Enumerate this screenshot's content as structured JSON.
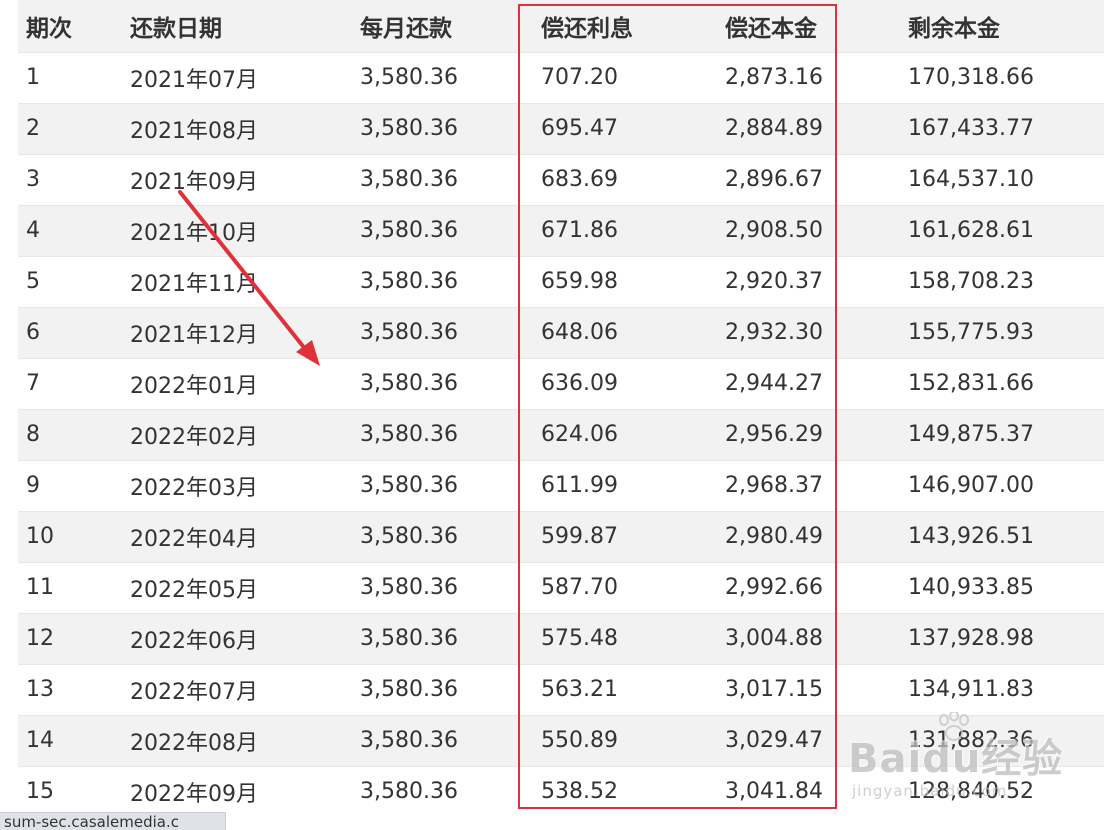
{
  "table": {
    "headers": [
      "期次",
      "还款日期",
      "每月还款",
      "偿还利息",
      "偿还本金",
      "剩余本金"
    ],
    "rows": [
      [
        "1",
        "2021年07月",
        "3,580.36",
        "707.20",
        "2,873.16",
        "170,318.66"
      ],
      [
        "2",
        "2021年08月",
        "3,580.36",
        "695.47",
        "2,884.89",
        "167,433.77"
      ],
      [
        "3",
        "2021年09月",
        "3,580.36",
        "683.69",
        "2,896.67",
        "164,537.10"
      ],
      [
        "4",
        "2021年10月",
        "3,580.36",
        "671.86",
        "2,908.50",
        "161,628.61"
      ],
      [
        "5",
        "2021年11月",
        "3,580.36",
        "659.98",
        "2,920.37",
        "158,708.23"
      ],
      [
        "6",
        "2021年12月",
        "3,580.36",
        "648.06",
        "2,932.30",
        "155,775.93"
      ],
      [
        "7",
        "2022年01月",
        "3,580.36",
        "636.09",
        "2,944.27",
        "152,831.66"
      ],
      [
        "8",
        "2022年02月",
        "3,580.36",
        "624.06",
        "2,956.29",
        "149,875.37"
      ],
      [
        "9",
        "2022年03月",
        "3,580.36",
        "611.99",
        "2,968.37",
        "146,907.00"
      ],
      [
        "10",
        "2022年04月",
        "3,580.36",
        "599.87",
        "2,980.49",
        "143,926.51"
      ],
      [
        "11",
        "2022年05月",
        "3,580.36",
        "587.70",
        "2,992.66",
        "140,933.85"
      ],
      [
        "12",
        "2022年06月",
        "3,580.36",
        "575.48",
        "3,004.88",
        "137,928.98"
      ],
      [
        "13",
        "2022年07月",
        "3,580.36",
        "563.21",
        "3,017.15",
        "134,911.83"
      ],
      [
        "14",
        "2022年08月",
        "3,580.36",
        "550.89",
        "3,029.47",
        "131,882.36"
      ],
      [
        "15",
        "2022年09月",
        "3,580.36",
        "538.52",
        "3,041.84",
        "128,840.52"
      ]
    ]
  },
  "annotation": {
    "highlight_color": "#d9333f",
    "arrow_color": "#e0303a"
  },
  "status_bar": {
    "text": "sum-sec.casalemedia.c"
  },
  "watermark": {
    "brand": "Baidu经验",
    "sub": "jingyan.baidu.com"
  }
}
